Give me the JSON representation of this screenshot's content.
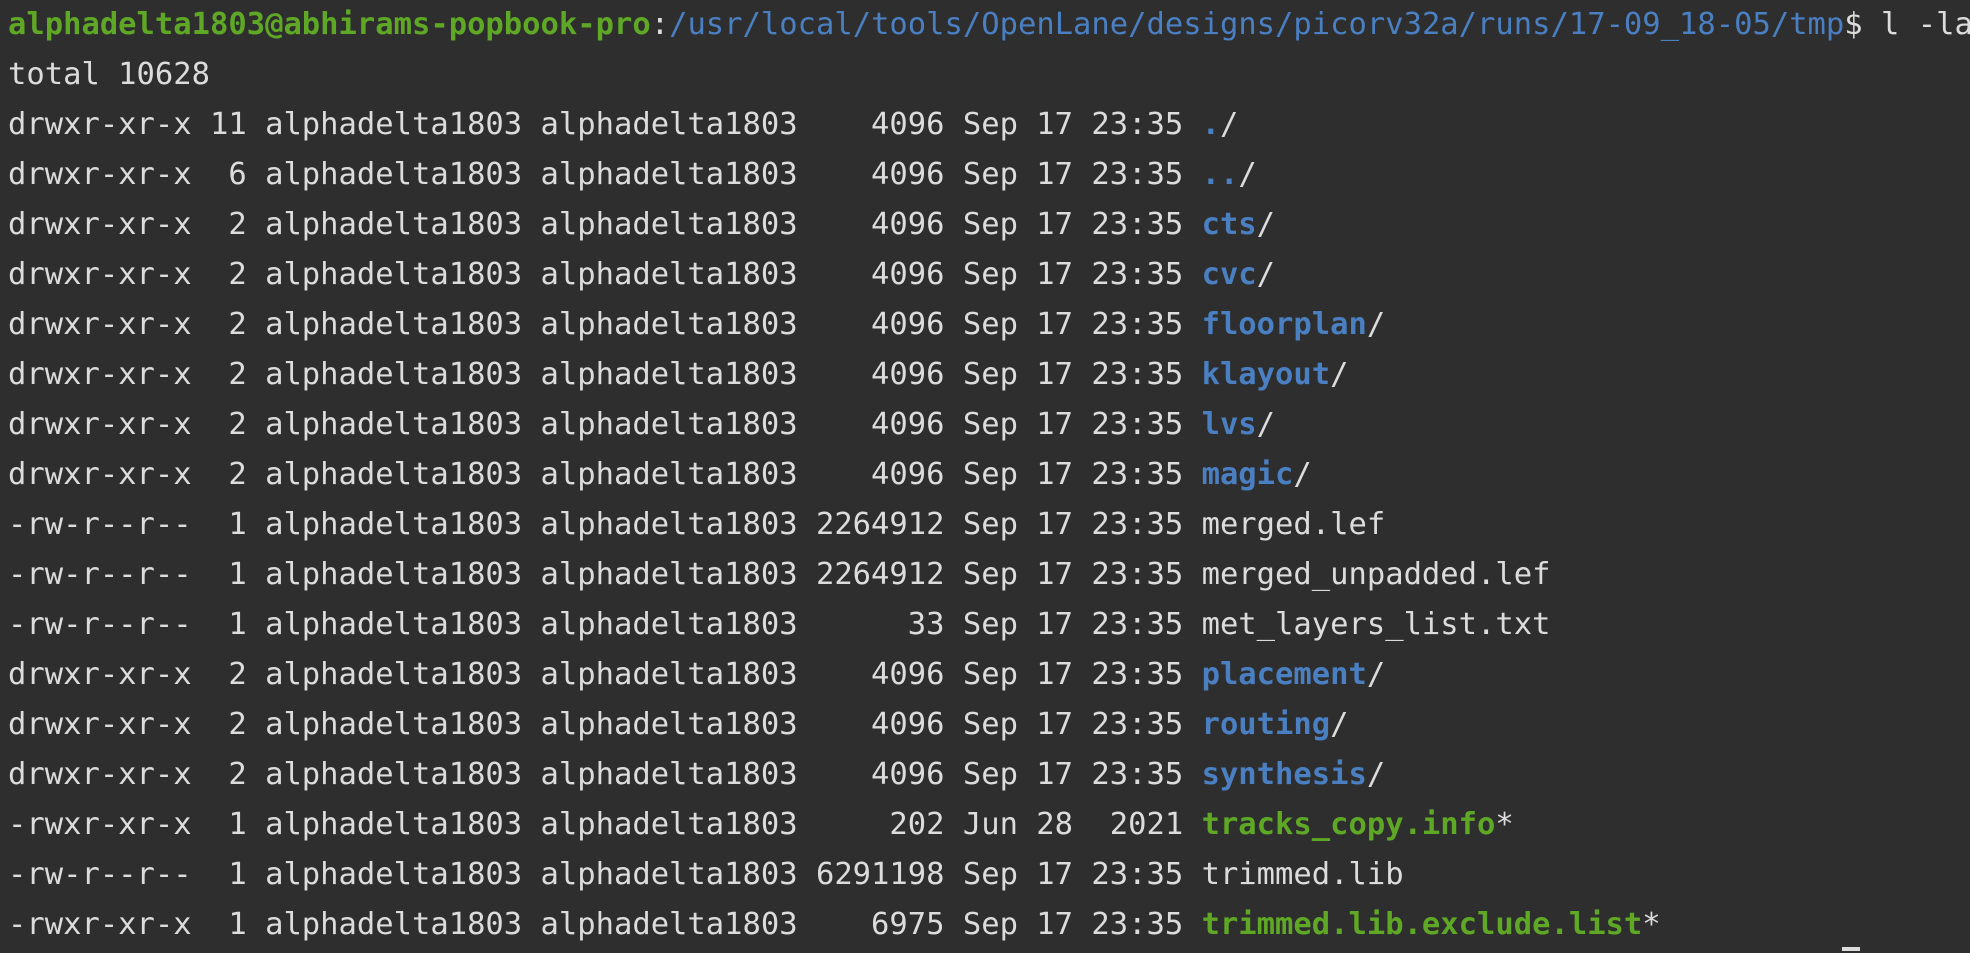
{
  "prompt": {
    "user_host": "alphadelta1803@abhirams-popbook-pro",
    "separator": ":",
    "path": "/usr/local/tools/OpenLane/designs/picorv32a/runs/17-09_18-05/tmp",
    "symbol": "$",
    "command": " l -la"
  },
  "total_line": "total 10628",
  "entries": [
    {
      "prefix": "drwxr-xr-x 11 alphadelta1803 alphadelta1803    4096 Sep 17 23:35 ",
      "name": ".",
      "type": "dir",
      "suffix": "/"
    },
    {
      "prefix": "drwxr-xr-x  6 alphadelta1803 alphadelta1803    4096 Sep 17 23:35 ",
      "name": "..",
      "type": "dir",
      "suffix": "/"
    },
    {
      "prefix": "drwxr-xr-x  2 alphadelta1803 alphadelta1803    4096 Sep 17 23:35 ",
      "name": "cts",
      "type": "dir",
      "suffix": "/"
    },
    {
      "prefix": "drwxr-xr-x  2 alphadelta1803 alphadelta1803    4096 Sep 17 23:35 ",
      "name": "cvc",
      "type": "dir",
      "suffix": "/"
    },
    {
      "prefix": "drwxr-xr-x  2 alphadelta1803 alphadelta1803    4096 Sep 17 23:35 ",
      "name": "floorplan",
      "type": "dir",
      "suffix": "/"
    },
    {
      "prefix": "drwxr-xr-x  2 alphadelta1803 alphadelta1803    4096 Sep 17 23:35 ",
      "name": "klayout",
      "type": "dir",
      "suffix": "/"
    },
    {
      "prefix": "drwxr-xr-x  2 alphadelta1803 alphadelta1803    4096 Sep 17 23:35 ",
      "name": "lvs",
      "type": "dir",
      "suffix": "/"
    },
    {
      "prefix": "drwxr-xr-x  2 alphadelta1803 alphadelta1803    4096 Sep 17 23:35 ",
      "name": "magic",
      "type": "dir",
      "suffix": "/"
    },
    {
      "prefix": "-rw-r--r--  1 alphadelta1803 alphadelta1803 2264912 Sep 17 23:35 ",
      "name": "merged.lef",
      "type": "file",
      "suffix": ""
    },
    {
      "prefix": "-rw-r--r--  1 alphadelta1803 alphadelta1803 2264912 Sep 17 23:35 ",
      "name": "merged_unpadded.lef",
      "type": "file",
      "suffix": ""
    },
    {
      "prefix": "-rw-r--r--  1 alphadelta1803 alphadelta1803      33 Sep 17 23:35 ",
      "name": "met_layers_list.txt",
      "type": "file",
      "suffix": ""
    },
    {
      "prefix": "drwxr-xr-x  2 alphadelta1803 alphadelta1803    4096 Sep 17 23:35 ",
      "name": "placement",
      "type": "dir",
      "suffix": "/"
    },
    {
      "prefix": "drwxr-xr-x  2 alphadelta1803 alphadelta1803    4096 Sep 17 23:35 ",
      "name": "routing",
      "type": "dir",
      "suffix": "/"
    },
    {
      "prefix": "drwxr-xr-x  2 alphadelta1803 alphadelta1803    4096 Sep 17 23:35 ",
      "name": "synthesis",
      "type": "dir",
      "suffix": "/"
    },
    {
      "prefix": "-rwxr-xr-x  1 alphadelta1803 alphadelta1803     202 Jun 28  2021 ",
      "name": "tracks_copy.info",
      "type": "exec",
      "suffix": "*"
    },
    {
      "prefix": "-rw-r--r--  1 alphadelta1803 alphadelta1803 6291198 Sep 17 23:35 ",
      "name": "trimmed.lib",
      "type": "file",
      "suffix": ""
    },
    {
      "prefix": "-rwxr-xr-x  1 alphadelta1803 alphadelta1803    6975 Sep 17 23:35 ",
      "name": "trimmed.lib.exclude.list",
      "type": "exec",
      "suffix": "*"
    }
  ],
  "colors": {
    "background": "#2e2e2e",
    "foreground": "#dcdcdc",
    "user_host": "#5fa826",
    "path": "#4a7fc1",
    "directory": "#4a7fc1",
    "executable": "#5fa826"
  }
}
